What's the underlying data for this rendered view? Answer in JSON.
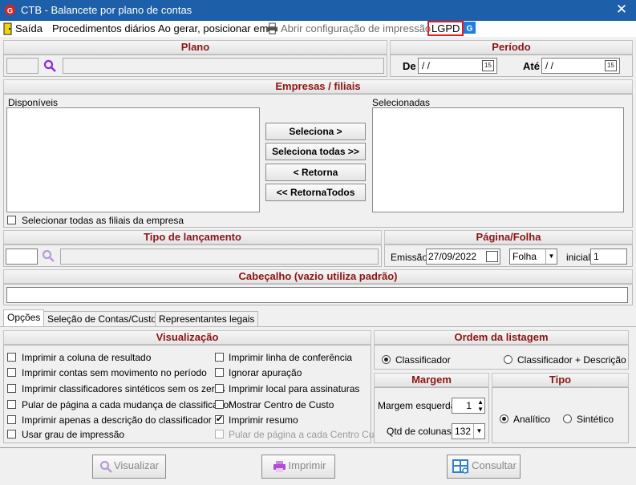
{
  "window": {
    "title": "CTB - Balancete por plano de contas",
    "close_icon": "close-icon"
  },
  "menu": {
    "exit": "Saída",
    "daily": "Procedimentos diários",
    "position": "Ao gerar, posicionar em",
    "print_config": "Abrir configuração de impressão",
    "lgpd": "LGPD"
  },
  "plano": {
    "header": "Plano",
    "code": "",
    "description": ""
  },
  "periodo": {
    "header": "Período",
    "de_label": "De",
    "de_value": " / /",
    "ate_label": "Até",
    "ate_value": " / /",
    "cal_text": "15"
  },
  "empresas": {
    "header": "Empresas / filiais",
    "available_label": "Disponíveis",
    "selected_label": "Selecionadas",
    "btn_select": "Seleciona >",
    "btn_select_all": "Seleciona todas >>",
    "btn_return": "< Retorna",
    "btn_return_all": "<< RetornaTodos",
    "select_all_filiais": "Selecionar todas as filiais da empresa"
  },
  "tipo_lancamento": {
    "header": "Tipo de lançamento",
    "code": "",
    "description": ""
  },
  "pagina": {
    "header": "Página/Folha",
    "emissao_label": "Emissão",
    "emissao_value": "27/09/2022",
    "folha_value": "Folha",
    "inicial_label": "inicial",
    "inicial_value": "1"
  },
  "cabecalho": {
    "header": "Cabeçalho (vazio utiliza padrão)",
    "value": ""
  },
  "tabs": [
    "Opções",
    "Seleção de Contas/Custos",
    "Representantes legais"
  ],
  "visualizacao": {
    "header": "Visualização",
    "left": [
      {
        "label": "Imprimir a coluna de resultado",
        "checked": false
      },
      {
        "label": "Imprimir contas sem movimento no período",
        "checked": false
      },
      {
        "label": "Imprimir classificadores sintéticos sem os zeros",
        "checked": false
      },
      {
        "label": "Pular de página a cada mudança de classificador",
        "checked": false
      },
      {
        "label": "Imprimir apenas a descrição do classificador",
        "checked": false
      },
      {
        "label": "Usar grau de impressão",
        "checked": false
      }
    ],
    "right": [
      {
        "label": "Imprimir linha de conferência",
        "checked": false
      },
      {
        "label": "Ignorar apuração",
        "checked": false
      },
      {
        "label": "Imprimir local para assinaturas",
        "checked": false
      },
      {
        "label": "Mostrar Centro de Custo",
        "checked": false
      },
      {
        "label": "Imprimir resumo",
        "checked": true
      },
      {
        "label": "Pular de página a cada Centro Custo",
        "checked": false,
        "disabled": true
      }
    ]
  },
  "ordem": {
    "header": "Ordem da listagem",
    "opt1": "Classificador",
    "opt2": "Classificador + Descrição"
  },
  "margem": {
    "header": "Margem",
    "left_label": "Margem esquerda",
    "left_value": "1",
    "cols_label": "Qtd de colunas",
    "cols_value": "132"
  },
  "tipo": {
    "header": "Tipo",
    "opt1": "Analítico",
    "opt2": "Sintético"
  },
  "footer": {
    "visualizar": "Visualizar",
    "imprimir": "Imprimir",
    "consultar": "Consultar"
  },
  "colors": {
    "title_bar": "#1d5fa8",
    "section_title": "#8c1414",
    "lgpd_border": "#e31b1b",
    "accent": "#8a2be2"
  }
}
